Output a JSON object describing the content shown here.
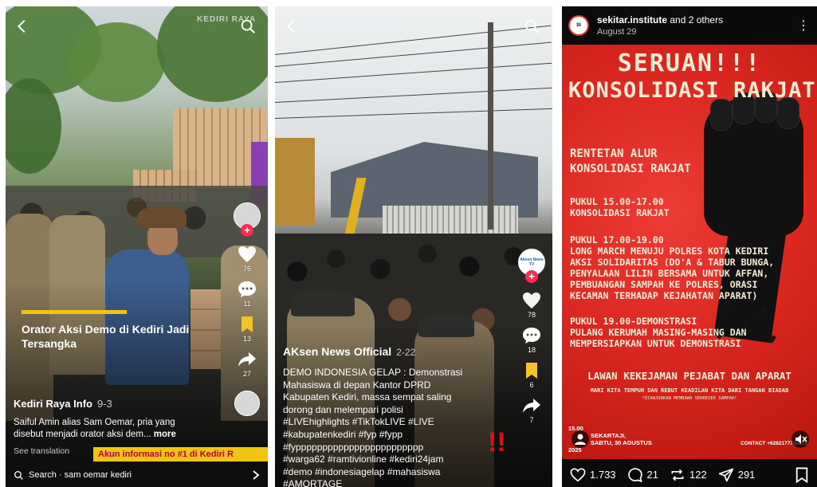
{
  "panel1": {
    "watermark": "KEDIRI RAYA",
    "title_overlay": "Orator Aksi Demo di Kediri Jadi Tersangka",
    "like_count": "76",
    "comment_count": "11",
    "save_count": "13",
    "share_count": "27",
    "creator": "Kediri Raya Info",
    "date": "9-3",
    "description": "Saiful Amin alias Sam Oemar, pria yang disebut menjadi orator aksi dem...",
    "more_label": "more",
    "see_translation": "See translation",
    "info_badge": "Akun informasi no #1 di Kediri R",
    "search_label": "Search · sam oemar kediri"
  },
  "panel2": {
    "title_overlay": "AKsen News Official",
    "date": "2-22",
    "avatar_label": "Aksen News TV",
    "like_count": "78",
    "comment_count": "18",
    "save_count": "6",
    "share_count": "7",
    "desc_line1": "DEMO INDONESIA GELAP : Demonstrasi",
    "desc_line2": "Mahasiswa di depan Kantor DPRD",
    "desc_line3": "Kabupaten Kediri, massa sempat saling",
    "desc_line4": "dorong dan melempari polisi",
    "tags_line1": "#LIVEhighlights #TikTokLIVE #LIVE",
    "tags_line2": "#kabupatenkediri #fyp #fypp",
    "tags_line3": "#fypppppppppppppppppppppppp",
    "tags_line4": "#warga62 #ramtivionline #kediri24jam",
    "tags_line5": "#demo #indonesiagelap #mahasiswa",
    "tags_line6": "#AMORTAGE"
  },
  "panel3": {
    "username": "sekitar.institute",
    "others": "and 2 others",
    "date": "August 29",
    "poster_title1": "SERUAN!!!",
    "poster_title2": "KONSOLIDASI RAKJAT",
    "poster_sub1": "RENTETAN ALUR",
    "poster_sub2": "KONSOLIDASI RAKJAT",
    "block1_line1": "PUKUL 15.00-17.00",
    "block1_line2": "KONSOLIDASI RAKJAT",
    "block2_line1": "PUKUL 17.00-19.00",
    "block2_line2": "LONG MARCH MENUJU POLRES KOTA KEDIRI",
    "block2_line3": "AKSI SOLIDARITAS (DO'A & TABUR BUNGA,",
    "block2_line4": "PENYALAAN LILIN BERSAMA UNTUK AFFAN,",
    "block2_line5": "PEMBUANGAN SAMPAH KE POLRES, ORASI",
    "block2_line6": "KECAMAN TERHADAP KEJAHATAN APARAT)",
    "block3_line1": "PUKUL 19.00-DEMONSTRASI",
    "block3_line2": "PULANG KERUMAH MASING-MASING DAN",
    "block3_line3": "MEMPERSIAPKAN UNTUK DEMONSTRASI",
    "footer": "LAWAN KEKEJAMAN PEJABAT DAN APARAT",
    "fine1": "MARI KITA TEMPUH DAN REBUT KEADILAN KITA DARI TANGAN BIADAB",
    "fine2": "*DIANJURKAN MEMBAWA SEKRESEK SAMPAH!",
    "time_line1": "15.00",
    "time_line2": "SEKARTAJI,",
    "time_line3": "SABTU, 30 AGUSTUS",
    "time_line4": "2025",
    "contact": "CONTACT +6282177793219",
    "likes": "1.733",
    "comments": "21",
    "reposts": "122",
    "shares": "291"
  }
}
